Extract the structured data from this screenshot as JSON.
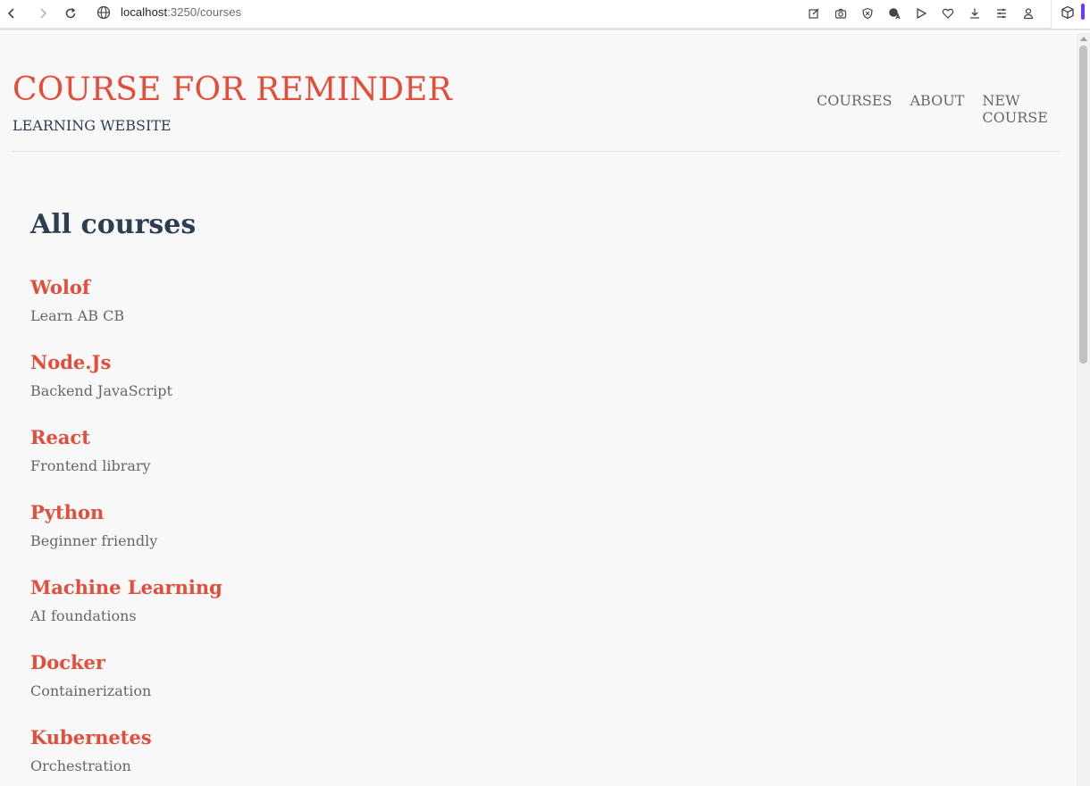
{
  "browser": {
    "url_host": "localhost",
    "url_rest": ":3250/courses"
  },
  "site": {
    "title": "COURSE FOR REMINDER",
    "subtitle": "LEARNING WEBSITE",
    "nav": [
      "COURSES",
      "ABOUT",
      "NEW COURSE"
    ]
  },
  "main": {
    "heading": "All courses",
    "courses": [
      {
        "title": "Wolof",
        "description": "Learn AB CB"
      },
      {
        "title": "Node.Js",
        "description": "Backend JavaScript"
      },
      {
        "title": "React",
        "description": "Frontend library"
      },
      {
        "title": "Python",
        "description": "Beginner friendly"
      },
      {
        "title": "Machine Learning",
        "description": "AI foundations"
      },
      {
        "title": "Docker",
        "description": "Containerization"
      },
      {
        "title": "Kubernetes",
        "description": "Orchestration"
      }
    ]
  },
  "colors": {
    "accent": "#e44d3a",
    "heading": "#2c3e50",
    "muted": "#666666",
    "background": "#f8f8f8"
  }
}
